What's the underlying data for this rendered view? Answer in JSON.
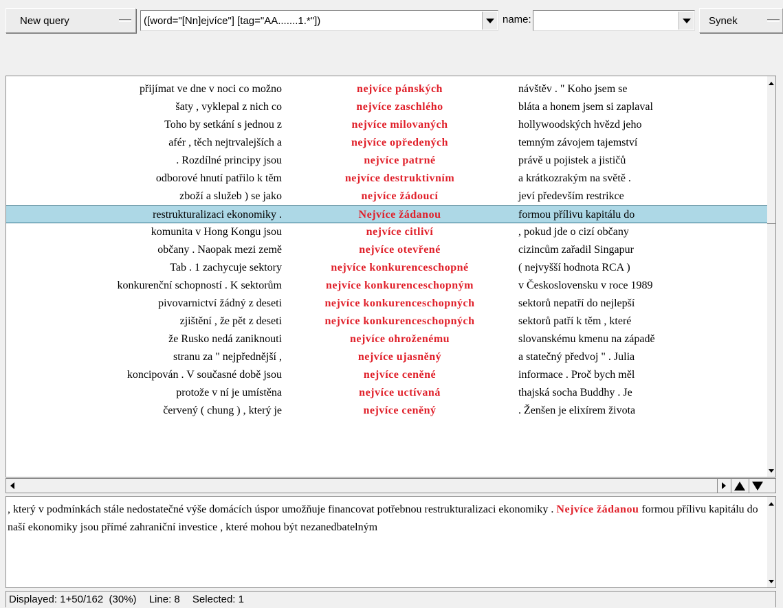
{
  "toolbar": {
    "new_query_label": "New query",
    "query_value": "([word=\"[Nn]ejvíce\"] [tag=\"AA.......1.*\"])",
    "name_label": "name:",
    "name_value": "",
    "synek_label": "Synek"
  },
  "concordance": {
    "rows": [
      {
        "left": "přijímat ve dne v noci co možno",
        "kwic": "nejvíce pánských",
        "right": "návštěv . \" Koho jsem se"
      },
      {
        "left": "šaty , vyklepal z nich co",
        "kwic": "nejvíce zaschlého",
        "right": "bláta a honem jsem si zaplaval"
      },
      {
        "left": "Toho by setkání s jednou z",
        "kwic": "nejvíce milovaných",
        "right": "hollywoodských hvězd jeho"
      },
      {
        "left": "afér , těch nejtrvalejších a",
        "kwic": "nejvíce opředených",
        "right": "temným závojem tajemství"
      },
      {
        "left": ". Rozdílné principy jsou",
        "kwic": "nejvíce patrné",
        "right": "právě u pojistek a jističů"
      },
      {
        "left": "odborové hnutí patřilo k těm",
        "kwic": "nejvíce destruktivním",
        "right": "a krátkozrakým na světě ."
      },
      {
        "left": "zboží a služeb ) se jako",
        "kwic": "nejvíce žádoucí",
        "right": "jeví především restrikce"
      },
      {
        "left": "restrukturalizaci ekonomiky .",
        "kwic": "Nejvíce žádanou",
        "right": "formou přílivu kapitálu do"
      },
      {
        "left": "komunita v Hong Kongu jsou",
        "kwic": "nejvíce citliví",
        "right": ", pokud jde o cizí občany"
      },
      {
        "left": "občany . Naopak mezi země",
        "kwic": "nejvíce otevřené",
        "right": "cizincům zařadil Singapur"
      },
      {
        "left": "Tab . 1 zachycuje sektory",
        "kwic": "nejvíce konkurenceschopné",
        "right": "( nejvyšší hodnota RCA )"
      },
      {
        "left": "konkurenční schopností . K sektorům",
        "kwic": "nejvíce konkurenceschopným",
        "right": "v Československu v roce 1989"
      },
      {
        "left": "pivovarnictví žádný z deseti",
        "kwic": "nejvíce konkurenceschopných",
        "right": "sektorů nepatří do nejlepší"
      },
      {
        "left": "zjištění , že pět z deseti",
        "kwic": "nejvíce konkurenceschopných",
        "right": "sektorů patří k těm , které"
      },
      {
        "left": "že Rusko nedá zaniknouti",
        "kwic": "nejvíce ohroženému",
        "right": "slovanskému kmenu na západě"
      },
      {
        "left": "stranu za \" nejpřednější ,",
        "kwic": "nejvíce ujasněný",
        "right": "a statečný předvoj \" . Julia"
      },
      {
        "left": "koncipován . V současné době jsou",
        "kwic": "nejvíce ceněné",
        "right": "informace . Proč bych měl"
      },
      {
        "left": "protože v ní je umístěna",
        "kwic": "nejvíce uctívaná",
        "right": "thajská socha Buddhy . Je"
      },
      {
        "left": "červený ( chung ) , který je",
        "kwic": "nejvíce ceněný",
        "right": ". Ženšen je elixírem života"
      }
    ],
    "selected_index": 7
  },
  "detail": {
    "before": ", který v podmínkách stále nedostatečné výše domácích úspor umožňuje financovat potřebnou restrukturalizaci ekonomiky .",
    "keyword": "Nejvíce žádanou",
    "after": "formou přílivu kapitálu do naší ekonomiky jsou přímé zahraniční investice , které mohou být nezanedbatelným"
  },
  "status": {
    "displayed": "Displayed: 1+50/162  (30%)",
    "line": "Line: 8",
    "selected": "Selected: 1"
  },
  "colors": {
    "keyword": "#e0202a",
    "selection": "#add8e6"
  }
}
